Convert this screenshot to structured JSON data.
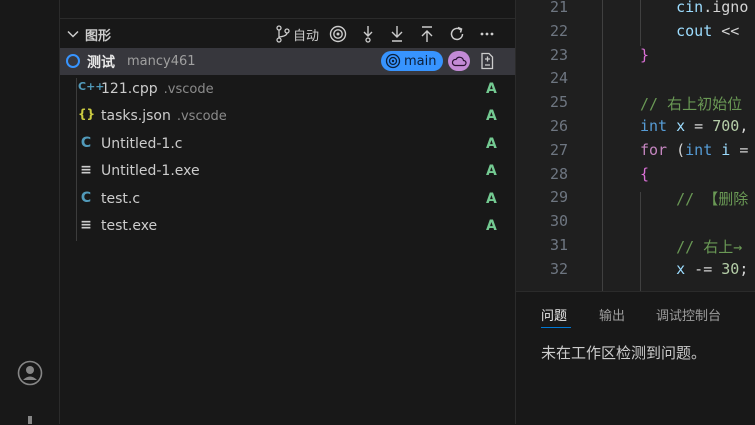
{
  "activity_bar": {
    "account_icon": "account-icon"
  },
  "scm": {
    "graph_title": "图形",
    "toolbar": {
      "branch_label": "自动"
    },
    "commit": {
      "message": "测试",
      "author": "mancy461",
      "branch": "main"
    },
    "files": [
      {
        "icon": "C++",
        "icon_color": "#519aba",
        "name": "121.cpp",
        "dir": ".vscode",
        "status": "A"
      },
      {
        "icon": "{}",
        "icon_color": "#cbcb41",
        "name": "tasks.json",
        "dir": ".vscode",
        "status": "A"
      },
      {
        "icon": "C",
        "icon_color": "#519aba",
        "name": "Untitled-1.c",
        "dir": "",
        "status": "A"
      },
      {
        "icon": "≡",
        "icon_color": "#cccccc",
        "name": "Untitled-1.exe",
        "dir": "",
        "status": "A"
      },
      {
        "icon": "C",
        "icon_color": "#519aba",
        "name": "test.c",
        "dir": "",
        "status": "A"
      },
      {
        "icon": "≡",
        "icon_color": "#cccccc",
        "name": "test.exe",
        "dir": "",
        "status": "A"
      }
    ]
  },
  "editor": {
    "lines": [
      {
        "num": "21",
        "code": "    cin.igno"
      },
      {
        "num": "22",
        "code": "    cout << "
      },
      {
        "num": "23",
        "code": "}"
      },
      {
        "num": "24",
        "code": ""
      },
      {
        "num": "25",
        "code": "// 右上初始位"
      },
      {
        "num": "26",
        "code": "int x = 700,"
      },
      {
        "num": "27",
        "code": "for (int i ="
      },
      {
        "num": "28",
        "code": "{"
      },
      {
        "num": "29",
        "code": "    // 【删除"
      },
      {
        "num": "30",
        "code": ""
      },
      {
        "num": "31",
        "code": "    // 右上→"
      },
      {
        "num": "32",
        "code": "    x -= 30;"
      }
    ]
  },
  "panel": {
    "tabs": [
      "问题",
      "输出",
      "调试控制台"
    ],
    "message": "未在工作区检测到问题。"
  },
  "colors": {
    "accent": "#3794ff",
    "added": "#73c991",
    "remote": "#c38ad6"
  }
}
